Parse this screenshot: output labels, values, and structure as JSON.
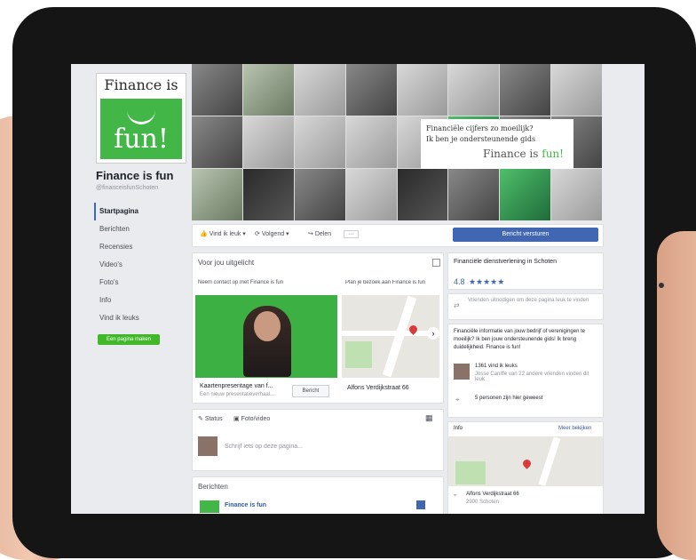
{
  "sidebar": {
    "logo_top": "Finance is",
    "logo_bottom": "fun!",
    "page_name": "Finance is fun",
    "page_handle": "@financeisfunSchoten",
    "nav": [
      "Startpagina",
      "Berichten",
      "Recensies",
      "Video's",
      "Foto's",
      "Info",
      "Vind ik leuks"
    ],
    "promote": "Een pagina maken"
  },
  "cover": {
    "text1": "Financiële cijfers zo moeilijk?",
    "text2": "Ik ben je ondersteunende gids",
    "brand": "Finance is",
    "brand_accent": "fun!"
  },
  "actions": {
    "like": "Vind ik leuk",
    "follow": "Volgend",
    "share": "Delen",
    "send": "Bericht versturen"
  },
  "suggested": {
    "title": "Voor jou uitgelicht",
    "tab1": "Neem contact op met Finance is fun",
    "tab2": "Plan je bezoek aan Finance is fun",
    "video_caption": "Kaartenpresentage van f...",
    "video_sub": "Een nieuw presentatieverhaal...",
    "video_btn": "Bericht",
    "map_caption": "Alfons Verdijkstraat 66"
  },
  "composer": {
    "status": "Status",
    "photo": "Foto/video",
    "placeholder": "Schrijf iets op deze pagina..."
  },
  "posts": {
    "title": "Berichten",
    "item": "Finance is fun"
  },
  "right": {
    "category": "Financiële dienstverlening in Schoten",
    "rating": "4.8",
    "stars": "★★★★★",
    "invite": "Vrienden uitnodigen om deze pagina leuk te vinden",
    "about": "Financiële informatie van jouw bedrijf of verenigingen te moeilijk? Ik ben jouw ondersteunende gids! Ik breng duidelijkheid. Finance is fun!",
    "likes": "1361 vind ik leuks",
    "likes_sub": "Josse Caniffe van 22 andere vrienden vinden dit leuk",
    "checkins": "5 personen zijn hier geweest",
    "map_label": "Info",
    "map_link": "Meer bekijken",
    "address": "Alfons Verdijkstraat 66",
    "city": "2900 Schoten"
  }
}
